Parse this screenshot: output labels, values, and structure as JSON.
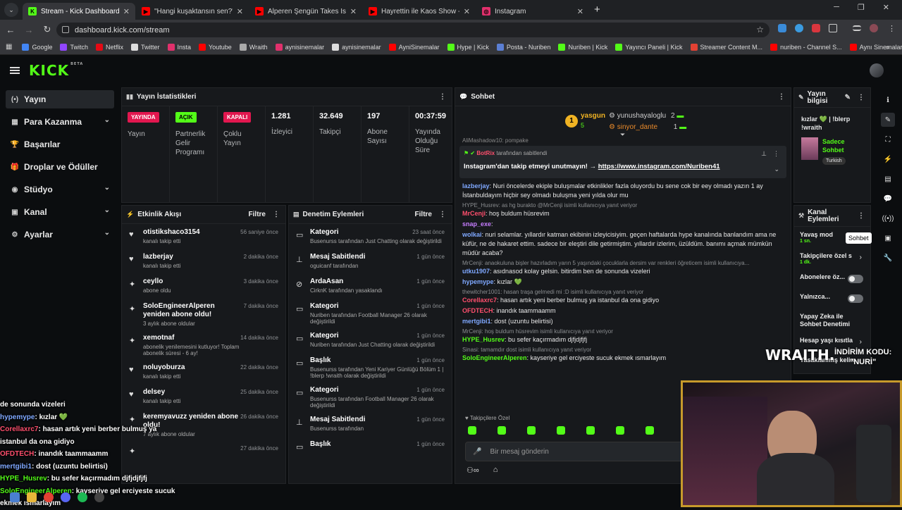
{
  "tabs": [
    {
      "title": "Stream - Kick Dashboard",
      "fav": "K",
      "color": "#53fc18",
      "active": true
    },
    {
      "title": "\"Hangi kuşaktansın sen?\" | Arda",
      "fav": "▶",
      "color": "#ff0000",
      "active": false
    },
    {
      "title": "Alperen Şengün Takes Istanbul",
      "fav": "▶",
      "color": "#ff0000",
      "active": false
    },
    {
      "title": "Hayrettin ile Kaos Show - 2.Sez",
      "fav": "▶",
      "color": "#ff0000",
      "active": false
    },
    {
      "title": "Instagram",
      "fav": "◎",
      "color": "#e1306c",
      "active": false
    }
  ],
  "address": {
    "url": "dashboard.kick.com/stream"
  },
  "bookmarks": [
    "Google",
    "Twitch",
    "Netflix",
    "Twitter",
    "Insta",
    "Youtube",
    "Wraith",
    "aynisinemalar",
    "aynisinemalar",
    "AyniSinemalar",
    "Hype | Kick",
    "Posta - Nuriben",
    "Nuriben | Kick",
    "Yayıncı Paneli | Kick",
    "Streamer Content M...",
    "nuriben - Channel S...",
    "Aynı Sinemalar - Ça..."
  ],
  "brand": {
    "logo": "KICK",
    "beta": "BETA",
    "accent": "#53fc18"
  },
  "nav": [
    {
      "label": "Yayın",
      "icon": "(•)",
      "active": true,
      "chev": false
    },
    {
      "label": "Para Kazanma",
      "icon": "▦",
      "active": false,
      "chev": true
    },
    {
      "label": "Başarılar",
      "icon": "🏆",
      "active": false,
      "chev": false
    },
    {
      "label": "Droplar ve Ödüller",
      "icon": "🎁",
      "active": false,
      "chev": false
    },
    {
      "label": "Stüdyo",
      "icon": "◉",
      "active": false,
      "chev": true
    },
    {
      "label": "Kanal",
      "icon": "▣",
      "active": false,
      "chev": true
    },
    {
      "label": "Ayarlar",
      "icon": "⚙",
      "active": false,
      "chev": true
    }
  ],
  "stats": {
    "title": "Yayın İstatistikleri",
    "badges": [
      {
        "badge": "YAYINDA",
        "color": "#e2174f",
        "label": "Yayın"
      },
      {
        "badge": "AÇIK",
        "color": "#53fc18",
        "label": "Partnerlik Gelir Programı"
      },
      {
        "badge": "KAPALI",
        "color": "#e2174f",
        "label": "Çoklu Yayın"
      }
    ],
    "values": [
      {
        "value": "1.281",
        "label": "İzleyici"
      },
      {
        "value": "32.649",
        "label": "Takipçi"
      },
      {
        "value": "197",
        "label": "Abone Sayısı"
      },
      {
        "value": "00:37:59",
        "label": "Yayında Olduğu Süre"
      }
    ]
  },
  "activity": {
    "title": "Etkinlik Akışı",
    "filter": "Filtre",
    "items": [
      {
        "icon": "♥",
        "name": "otistikshaco3154",
        "desc": "kanalı takip etti",
        "time": "56 saniye önce"
      },
      {
        "icon": "♥",
        "name": "lazberjay",
        "desc": "kanalı takip etti",
        "time": "2 dakika önce"
      },
      {
        "icon": "✦",
        "name": "ceyllo",
        "desc": "abone oldu",
        "time": "3 dakika önce"
      },
      {
        "icon": "✦",
        "name": "SoloEngineerAlperen yeniden abone oldu!",
        "desc": "3 aylık abone oldular",
        "time": "7 dakika önce"
      },
      {
        "icon": "✦",
        "name": "xemotnaf",
        "desc": "abonelik yenilemesini kutluyor! Toplam abonelik süresi - 6 ay!",
        "time": "14 dakika önce"
      },
      {
        "icon": "♥",
        "name": "noluyoburza",
        "desc": "kanalı takip etti",
        "time": "22 dakika önce"
      },
      {
        "icon": "♥",
        "name": "delsey",
        "desc": "kanalı takip etti",
        "time": "25 dakika önce"
      },
      {
        "icon": "✦",
        "name": "keremyavuzz yeniden abone oldu!",
        "desc": "7 aylık abone oldular",
        "time": "26 dakika önce"
      },
      {
        "icon": "✦",
        "name": "",
        "desc": "",
        "time": "27 dakika önce"
      }
    ]
  },
  "moderation": {
    "title": "Denetim Eylemleri",
    "filter": "Filtre",
    "items": [
      {
        "icon": "▭",
        "name": "Kategori",
        "desc": "Busenurss tarafından Just Chatting olarak değiştirildi",
        "time": "23 saat önce"
      },
      {
        "icon": "⊥",
        "name": "Mesaj Sabitlendi",
        "desc": "oguicanf tarafından",
        "time": "1 gün önce"
      },
      {
        "icon": "⊘",
        "name": "ArdaAsan",
        "desc": "CirknK tarafından yasaklandı",
        "time": "1 gün önce"
      },
      {
        "icon": "▭",
        "name": "Kategori",
        "desc": "Nuriben tarafından Football Manager 26 olarak değiştirildi",
        "time": "1 gün önce"
      },
      {
        "icon": "▭",
        "name": "Kategori",
        "desc": "Nuriben tarafından Just Chatting olarak değiştirildi",
        "time": "1 gün önce"
      },
      {
        "icon": "▭",
        "name": "Başlık",
        "desc": "Busenurss tarafından Yeni Kariyer Günlüğü Bölüm 1 | !blerp !wraith olarak değiştirildi",
        "time": "1 gün önce"
      },
      {
        "icon": "▭",
        "name": "Kategori",
        "desc": "Busenurss tarafından Football Manager 26 olarak değiştirildi",
        "time": "1 gün önce"
      },
      {
        "icon": "⊥",
        "name": "Mesaj Sabitlendi",
        "desc": "Busenurss tarafından",
        "time": "1 gün önce"
      },
      {
        "icon": "▭",
        "name": "Başlık",
        "desc": "",
        "time": "1 gün önce"
      }
    ]
  },
  "chat": {
    "title": "Sohbet",
    "leaders": {
      "first": "yasgun",
      "first_count": "5",
      "second": "yunushayaloglu",
      "second_count": "2",
      "third": "sinyor_dante",
      "third_count": "1"
    },
    "partial_top": "AliMashadow10: pompake",
    "pinned": {
      "user": "BotRix",
      "by": "tarafından sabitlendi",
      "text": "Instagram'dan takip etmeyi unutmayın! →",
      "link": "https://www.instagram.com/Nuriben41"
    },
    "messages": [
      {
        "user": "lazberjay",
        "color": "#7fa8ff",
        "text": "Nuri öncelerde ekiple buluşmalar etkinlikler fazla oluyordu bu sene cok bir eey olmadı yazın 1 ay İstanbuldayım hiçbir sey olmadı buluşma yeni yılda olur mu"
      },
      {
        "reply": "HYPE_Husrev: as hg burakto @MrCenji",
        "suffix": "isimli kullanıcıya yanıt veriyor"
      },
      {
        "user": "MrCenji",
        "color": "#ff4f6d",
        "text": "hoş buldum hüsrevim"
      },
      {
        "user": "snap_exe",
        "color": "#c77dff",
        "text": ""
      },
      {
        "user": "wolkai",
        "color": "#7fa8ff",
        "text": "nuri selamlar. yıllardır katman ekibinin izleyicisiyim. geçen haftalarda hype kanalında banlandım ama ne küfür, ne de hakaret ettim. sadece bir eleştiri dile getirmiştim. yıllardır izlerim, üzüldüm. banımı açmak mümkün müdür acaba?"
      },
      {
        "reply": "MrCenji: anaokuluna bişler hazırladım yarın 5 yaşındaki çocuklarla dersim var renkleri öğreticem",
        "suffix": "isimli kullanıcıya..."
      },
      {
        "user": "utku1907",
        "color": "#7fa8ff",
        "text": "asıdnasod kolay gelsin. bitirdim ben de sonunda vizeleri"
      },
      {
        "user": "hypemype",
        "color": "#7fa8ff",
        "text": "kızlar 💚"
      },
      {
        "reply": "thewitcher1001: hasan traşa gelmedi mi :D",
        "suffix": "isimli kullanıcıya yanıt veriyor"
      },
      {
        "user": "Corellaxrc7",
        "color": "#ff4f6d",
        "text": "hasan artık yeni berber bulmuş ya istanbul da ona gidiyo"
      },
      {
        "user": "OFDTECH",
        "color": "#ff4f6d",
        "text": "inandık taammaamm"
      },
      {
        "user": "mertgibi1",
        "color": "#7fa8ff",
        "text": "dost (uzuntu belirtisi)"
      },
      {
        "reply": "MrCenji: hoş buldum hüsrevim",
        "suffix": "isimli kullanıcıya yanıt veriyor"
      },
      {
        "user": "HYPE_Husrev",
        "color": "#53fc18",
        "text": "bu sefer kaçırmadım djfjdjfjfj"
      },
      {
        "reply": "Sinasi: tamamdır dost",
        "suffix": "isimli kullanıcıya yanıt veriyor"
      },
      {
        "user": "SoloEngineerAlperen",
        "color": "#53fc18",
        "text": "kayseriye gel erciyeste sucuk ekmek ısmarlayım"
      }
    ],
    "followers_only": "Takipçilere Özel",
    "placeholder": "Bir mesaj gönderin"
  },
  "streaminfo": {
    "title": "Yayın bilgisi",
    "text": "kızlar 💚 | !blerp !wraith",
    "category": "Sadece Sohbet",
    "lang": "Turkish"
  },
  "channel": {
    "title": "Kanal Eylemleri",
    "rows": [
      {
        "label": "Yavaş mod",
        "sub": "1 sn."
      },
      {
        "label": "Takipçilere özel s",
        "sub": "1 dk."
      },
      {
        "label": "Abonelere öz..."
      },
      {
        "label": "Yalnızca..."
      },
      {
        "label": "Yapay Zeka ile Sohbet Denetimi"
      },
      {
        "label": "Hesap yaşı kısıtla"
      },
      {
        "label": "Yasaklanmış kelim"
      }
    ],
    "tooltip": "Sohbet"
  },
  "overlay": {
    "chat": [
      {
        "user": "",
        "text": "de sonunda vizeleri"
      },
      {
        "user": "hypemype",
        "text": ": kızlar 💚",
        "color": "#7fa8ff"
      },
      {
        "user": "Corellaxrc7",
        "text": ": hasan artık yeni berber bulmuş ya",
        "color": "#ff4f6d"
      },
      {
        "user": "",
        "text": "istanbul da ona gidiyo"
      },
      {
        "user": "OFDTECH",
        "text": ": inandık taammaamm",
        "color": "#ff4f6d"
      },
      {
        "user": "mertgibi1",
        "text": ": dost (uzuntu belirtisi)",
        "color": "#7fa8ff"
      },
      {
        "user": "HYPE_Husrev",
        "text": ": bu sefer kaçırmadım djfjdjfjfj",
        "color": "#53fc18"
      },
      {
        "user": "SoloEngineerAlperen",
        "text": ": kayseriye gel erciyeste sucuk",
        "color": "#53fc18"
      },
      {
        "user": "",
        "text": "ekmek ısmarlayım"
      }
    ],
    "sponsor": "WRAITH.",
    "discount": "İNDİRİM KODU:",
    "code": "\"NURİ\""
  }
}
